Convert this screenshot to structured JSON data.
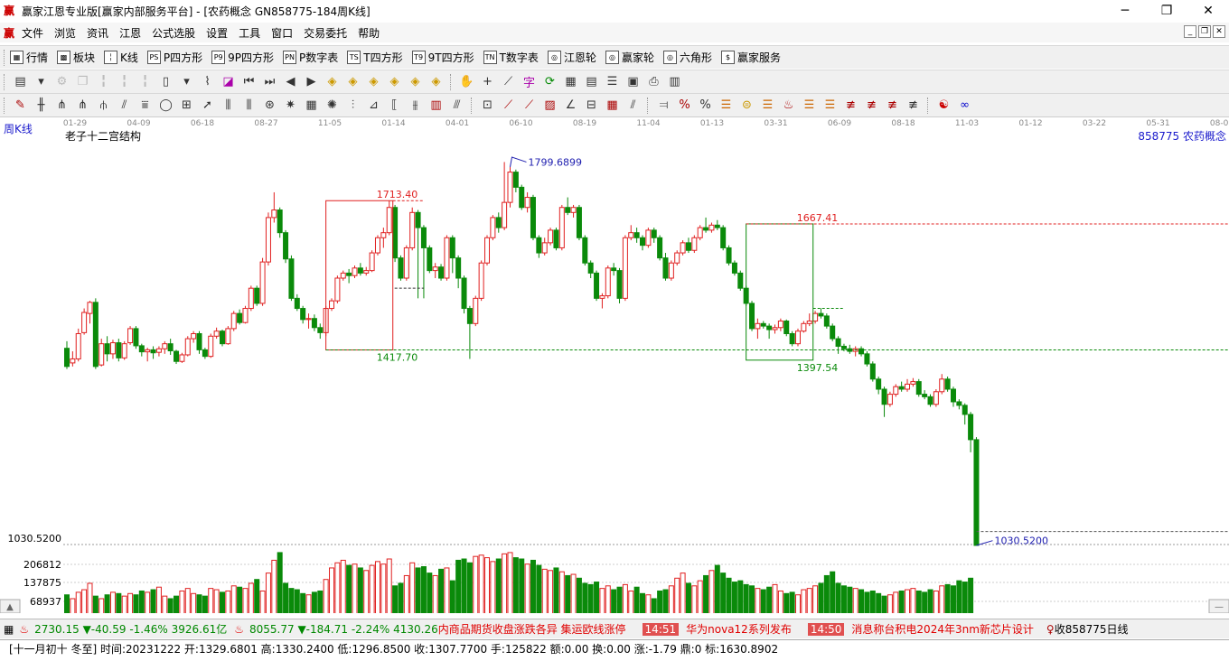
{
  "window": {
    "title": "赢家江恩专业版[赢家内部服务平台] - [农药概念  GN858775-184周K线]",
    "logo_char": "赢"
  },
  "menu": {
    "items": [
      "文件",
      "浏览",
      "资讯",
      "江恩",
      "公式选股",
      "设置",
      "工具",
      "窗口",
      "交易委托",
      "帮助"
    ]
  },
  "toolbar1": {
    "items": [
      {
        "icon": "grid-icon",
        "glyph": "▦",
        "label": "行情"
      },
      {
        "icon": "blocks-icon",
        "glyph": "▩",
        "label": "板块"
      },
      {
        "icon": "candles-icon",
        "glyph": "╎",
        "label": "K线"
      },
      {
        "icon": "ps-icon",
        "glyph": "PS",
        "label": "P四方形"
      },
      {
        "icon": "p9-icon",
        "glyph": "P9",
        "label": "9P四方形"
      },
      {
        "icon": "pn-icon",
        "glyph": "PN",
        "label": "P数字表"
      },
      {
        "icon": "ts-icon",
        "glyph": "TS",
        "label": "T四方形"
      },
      {
        "icon": "t9-icon",
        "glyph": "T9",
        "label": "9T四方形"
      },
      {
        "icon": "tn-icon",
        "glyph": "TN",
        "label": "T数字表"
      },
      {
        "icon": "gann-wheel-icon",
        "glyph": "◎",
        "label": "江恩轮"
      },
      {
        "icon": "winner-wheel-icon",
        "glyph": "◎",
        "label": "赢家轮"
      },
      {
        "icon": "hexagon-icon",
        "glyph": "◎",
        "label": "六角形"
      },
      {
        "icon": "dollar-icon",
        "glyph": "$",
        "label": "赢家服务"
      }
    ]
  },
  "chart": {
    "period_label": "周K线",
    "indicator_name": "老子十二宫结构",
    "security": "858775 农药概念",
    "axis_dates": [
      "01-29",
      "04-09",
      "06-18",
      "08-27",
      "11-05",
      "01-14",
      "04-01",
      "06-10",
      "08-19",
      "11-04",
      "01-13",
      "03-31",
      "06-09",
      "08-18",
      "11-03",
      "01-12",
      "03-22",
      "05-31",
      "08-09"
    ],
    "price_low_axis_label": "1030.5200",
    "vol_axis_labels": [
      "206812",
      "137875",
      "68937"
    ],
    "annotations": {
      "high": "1799.6899",
      "box1_top": "1713.40",
      "box1_bottom": "1417.70",
      "box2_top": "1667.41",
      "box2_bottom": "1397.54",
      "last_low": "1030.5200"
    },
    "colors": {
      "up": "#e02020",
      "down": "#0a8a0a",
      "box1": "#e02020",
      "box2": "#0a8a0a",
      "high_label": "#2020b0"
    }
  },
  "chart_data": {
    "type": "candlestick",
    "x_start": "2018-01-29",
    "interval": "week",
    "price_range": [
      1030.52,
      1799.69
    ],
    "volume_max": 275000,
    "candles": [
      [
        1421,
        1385,
        1435,
        1380
      ],
      [
        1392,
        1400,
        1415,
        1385
      ],
      [
        1400,
        1450,
        1460,
        1395
      ],
      [
        1452,
        1492,
        1500,
        1448
      ],
      [
        1490,
        1512,
        1515,
        1470
      ],
      [
        1512,
        1385,
        1520,
        1380
      ],
      [
        1388,
        1430,
        1440,
        1385
      ],
      [
        1430,
        1410,
        1445,
        1395
      ],
      [
        1410,
        1432,
        1438,
        1400
      ],
      [
        1432,
        1402,
        1440,
        1395
      ],
      [
        1402,
        1430,
        1435,
        1398
      ],
      [
        1432,
        1460,
        1465,
        1428
      ],
      [
        1460,
        1426,
        1465,
        1420
      ],
      [
        1426,
        1414,
        1430,
        1405
      ],
      [
        1414,
        1418,
        1422,
        1395
      ],
      [
        1418,
        1412,
        1425,
        1400
      ],
      [
        1413,
        1420,
        1425,
        1405
      ],
      [
        1420,
        1430,
        1435,
        1410
      ],
      [
        1430,
        1416,
        1440,
        1408
      ],
      [
        1415,
        1395,
        1418,
        1390
      ],
      [
        1395,
        1408,
        1412,
        1392
      ],
      [
        1408,
        1440,
        1445,
        1405
      ],
      [
        1440,
        1450,
        1455,
        1432
      ],
      [
        1450,
        1418,
        1455,
        1410
      ],
      [
        1418,
        1405,
        1422,
        1400
      ],
      [
        1405,
        1445,
        1450,
        1402
      ],
      [
        1445,
        1455,
        1462,
        1440
      ],
      [
        1455,
        1430,
        1458,
        1425
      ],
      [
        1430,
        1460,
        1465,
        1428
      ],
      [
        1460,
        1490,
        1495,
        1455
      ],
      [
        1490,
        1472,
        1498,
        1468
      ],
      [
        1472,
        1500,
        1505,
        1470
      ],
      [
        1500,
        1540,
        1545,
        1495
      ],
      [
        1540,
        1510,
        1545,
        1505
      ],
      [
        1510,
        1592,
        1600,
        1505
      ],
      [
        1592,
        1680,
        1690,
        1585
      ],
      [
        1680,
        1695,
        1730,
        1670
      ],
      [
        1695,
        1650,
        1700,
        1640
      ],
      [
        1650,
        1598,
        1655,
        1590
      ],
      [
        1598,
        1520,
        1605,
        1515
      ],
      [
        1520,
        1500,
        1528,
        1495
      ],
      [
        1500,
        1478,
        1505,
        1470
      ],
      [
        1478,
        1480,
        1490,
        1460
      ],
      [
        1480,
        1462,
        1488,
        1455
      ],
      [
        1462,
        1452,
        1470,
        1440
      ],
      [
        1452,
        1500,
        1505,
        1445
      ],
      [
        1500,
        1515,
        1520,
        1495
      ],
      [
        1515,
        1560,
        1565,
        1510
      ],
      [
        1560,
        1570,
        1575,
        1555
      ],
      [
        1570,
        1565,
        1578,
        1550
      ],
      [
        1565,
        1580,
        1585,
        1560
      ],
      [
        1580,
        1570,
        1590,
        1565
      ],
      [
        1570,
        1575,
        1582,
        1565
      ],
      [
        1575,
        1610,
        1615,
        1572
      ],
      [
        1610,
        1640,
        1645,
        1605
      ],
      [
        1640,
        1650,
        1660,
        1620
      ],
      [
        1650,
        1700,
        1713,
        1645
      ],
      [
        1700,
        1600,
        1705,
        1592
      ],
      [
        1600,
        1560,
        1605,
        1555
      ],
      [
        1560,
        1620,
        1625,
        1555
      ],
      [
        1620,
        1690,
        1700,
        1615
      ],
      [
        1690,
        1660,
        1695,
        1520
      ],
      [
        1660,
        1620,
        1665,
        1520
      ],
      [
        1620,
        1575,
        1625,
        1570
      ],
      [
        1575,
        1582,
        1590,
        1560
      ],
      [
        1582,
        1560,
        1588,
        1555
      ],
      [
        1560,
        1640,
        1645,
        1555
      ],
      [
        1640,
        1600,
        1645,
        1570
      ],
      [
        1600,
        1560,
        1605,
        1540
      ],
      [
        1560,
        1500,
        1565,
        1490
      ],
      [
        1500,
        1470,
        1505,
        1400
      ],
      [
        1470,
        1520,
        1525,
        1465
      ],
      [
        1520,
        1590,
        1595,
        1515
      ],
      [
        1590,
        1640,
        1645,
        1585
      ],
      [
        1640,
        1680,
        1685,
        1635
      ],
      [
        1680,
        1660,
        1690,
        1650
      ],
      [
        1660,
        1710,
        1790,
        1655
      ],
      [
        1710,
        1770,
        1780,
        1700
      ],
      [
        1770,
        1740,
        1775,
        1730
      ],
      [
        1740,
        1700,
        1745,
        1695
      ],
      [
        1700,
        1720,
        1730,
        1690
      ],
      [
        1720,
        1640,
        1725,
        1635
      ],
      [
        1640,
        1610,
        1645,
        1600
      ],
      [
        1610,
        1630,
        1640,
        1605
      ],
      [
        1630,
        1655,
        1660,
        1625
      ],
      [
        1655,
        1620,
        1660,
        1615
      ],
      [
        1620,
        1700,
        1705,
        1615
      ],
      [
        1700,
        1690,
        1720,
        1685
      ],
      [
        1690,
        1700,
        1705,
        1680
      ],
      [
        1700,
        1640,
        1705,
        1635
      ],
      [
        1640,
        1590,
        1645,
        1585
      ],
      [
        1590,
        1570,
        1595,
        1560
      ],
      [
        1570,
        1520,
        1575,
        1515
      ],
      [
        1520,
        1525,
        1530,
        1500
      ],
      [
        1525,
        1580,
        1585,
        1520
      ],
      [
        1580,
        1575,
        1590,
        1565
      ],
      [
        1575,
        1520,
        1580,
        1510
      ],
      [
        1520,
        1640,
        1645,
        1515
      ],
      [
        1640,
        1650,
        1665,
        1635
      ],
      [
        1650,
        1640,
        1660,
        1630
      ],
      [
        1640,
        1625,
        1645,
        1615
      ],
      [
        1625,
        1655,
        1660,
        1620
      ],
      [
        1655,
        1640,
        1660,
        1630
      ],
      [
        1640,
        1600,
        1645,
        1595
      ],
      [
        1600,
        1560,
        1610,
        1555
      ],
      [
        1560,
        1590,
        1595,
        1555
      ],
      [
        1590,
        1610,
        1615,
        1585
      ],
      [
        1610,
        1630,
        1635,
        1605
      ],
      [
        1630,
        1615,
        1640,
        1610
      ],
      [
        1615,
        1640,
        1645,
        1610
      ],
      [
        1640,
        1660,
        1665,
        1635
      ],
      [
        1660,
        1655,
        1680,
        1650
      ],
      [
        1655,
        1665,
        1670,
        1650
      ],
      [
        1665,
        1660,
        1675,
        1655
      ],
      [
        1660,
        1620,
        1665,
        1615
      ],
      [
        1620,
        1590,
        1625,
        1585
      ],
      [
        1590,
        1570,
        1595,
        1565
      ],
      [
        1570,
        1540,
        1575,
        1535
      ],
      [
        1540,
        1510,
        1545,
        1505
      ],
      [
        1510,
        1460,
        1515,
        1455
      ],
      [
        1460,
        1470,
        1480,
        1440
      ],
      [
        1470,
        1465,
        1475,
        1460
      ],
      [
        1465,
        1458,
        1470,
        1440
      ],
      [
        1458,
        1462,
        1468,
        1450
      ],
      [
        1462,
        1475,
        1480,
        1455
      ],
      [
        1475,
        1450,
        1478,
        1445
      ],
      [
        1450,
        1430,
        1455,
        1425
      ],
      [
        1430,
        1455,
        1460,
        1425
      ],
      [
        1455,
        1470,
        1475,
        1452
      ],
      [
        1470,
        1475,
        1490,
        1465
      ],
      [
        1475,
        1490,
        1495,
        1470
      ],
      [
        1490,
        1485,
        1500,
        1480
      ],
      [
        1485,
        1465,
        1490,
        1460
      ],
      [
        1465,
        1440,
        1470,
        1435
      ],
      [
        1440,
        1425,
        1445,
        1410
      ],
      [
        1425,
        1420,
        1430,
        1415
      ],
      [
        1420,
        1415,
        1428,
        1410
      ],
      [
        1415,
        1420,
        1425,
        1405
      ],
      [
        1420,
        1410,
        1425,
        1405
      ],
      [
        1410,
        1390,
        1415,
        1385
      ],
      [
        1390,
        1360,
        1395,
        1355
      ],
      [
        1360,
        1340,
        1365,
        1330
      ],
      [
        1340,
        1310,
        1345,
        1285
      ],
      [
        1310,
        1330,
        1335,
        1305
      ],
      [
        1330,
        1345,
        1350,
        1325
      ],
      [
        1345,
        1340,
        1355,
        1335
      ],
      [
        1340,
        1350,
        1360,
        1335
      ],
      [
        1350,
        1355,
        1362,
        1345
      ],
      [
        1355,
        1330,
        1360,
        1325
      ],
      [
        1330,
        1325,
        1338,
        1320
      ],
      [
        1325,
        1310,
        1330,
        1305
      ],
      [
        1310,
        1335,
        1340,
        1305
      ],
      [
        1335,
        1360,
        1370,
        1330
      ],
      [
        1360,
        1340,
        1365,
        1335
      ],
      [
        1340,
        1315,
        1345,
        1305
      ],
      [
        1315,
        1308,
        1320,
        1300
      ],
      [
        1308,
        1290,
        1312,
        1270
      ],
      [
        1290,
        1240,
        1295,
        1215
      ],
      [
        1240,
        1030.52,
        1245,
        1030.52
      ]
    ],
    "volumes": [
      75000,
      60000,
      85000,
      95000,
      120000,
      70000,
      60000,
      75000,
      85000,
      80000,
      70000,
      80000,
      75000,
      90000,
      85000,
      95000,
      105000,
      70000,
      60000,
      70000,
      90000,
      100000,
      80000,
      75000,
      70000,
      100000,
      95000,
      85000,
      90000,
      110000,
      105000,
      100000,
      120000,
      135000,
      90000,
      160000,
      210000,
      240000,
      120000,
      100000,
      95000,
      80000,
      75000,
      85000,
      90000,
      135000,
      180000,
      200000,
      210000,
      190000,
      195000,
      180000,
      170000,
      190000,
      205000,
      195000,
      215000,
      110000,
      120000,
      150000,
      200000,
      180000,
      185000,
      160000,
      150000,
      175000,
      180000,
      130000,
      210000,
      215000,
      200000,
      225000,
      230000,
      220000,
      205000,
      215000,
      235000,
      240000,
      220000,
      215000,
      195000,
      210000,
      190000,
      175000,
      170000,
      180000,
      165000,
      150000,
      155000,
      140000,
      120000,
      115000,
      125000,
      100000,
      110000,
      95000,
      105000,
      115000,
      90000,
      105000,
      80000,
      75000,
      60000,
      90000,
      95000,
      110000,
      140000,
      160000,
      120000,
      110000,
      130000,
      150000,
      170000,
      190000,
      160000,
      140000,
      125000,
      130000,
      115000,
      110000,
      100000,
      95000,
      105000,
      115000,
      90000,
      80000,
      85000,
      75000,
      95000,
      100000,
      110000,
      120000,
      150000,
      165000,
      120000,
      110000,
      105000,
      100000,
      95000,
      85000,
      90000,
      80000,
      70000,
      75000,
      85000,
      90000,
      95000,
      100000,
      90000,
      85000,
      95000,
      90000,
      110000,
      115000,
      110000,
      130000,
      125000,
      140000
    ]
  },
  "statusbar": {
    "sh_index": "2730.15",
    "sh_change": "▼-40.59",
    "sh_pct": "-1.46%",
    "sh_amount": "3926.61亿",
    "sz_index": "8055.77",
    "sz_change": "▼-184.71",
    "sz_pct": "-2.24%",
    "sz_amount": "4130.26",
    "ticker_1": "内商品期货收盘涨跌各异 集运欧线涨停",
    "time_2": "14:51",
    "news_2": "华为nova12系列发布",
    "time_3": "14:50",
    "news_3": "消息称台积电2024年3nm新芯片设计",
    "watch": "收858775日线"
  },
  "infobar": {
    "text": "[十一月初十 冬至] 时间:20231222 开:1329.6801 高:1330.2400 低:1296.8500 收:1307.7700 手:125822 额:0.00 换:0.00 涨:-1.79 鼎:0 标:1630.8902"
  }
}
